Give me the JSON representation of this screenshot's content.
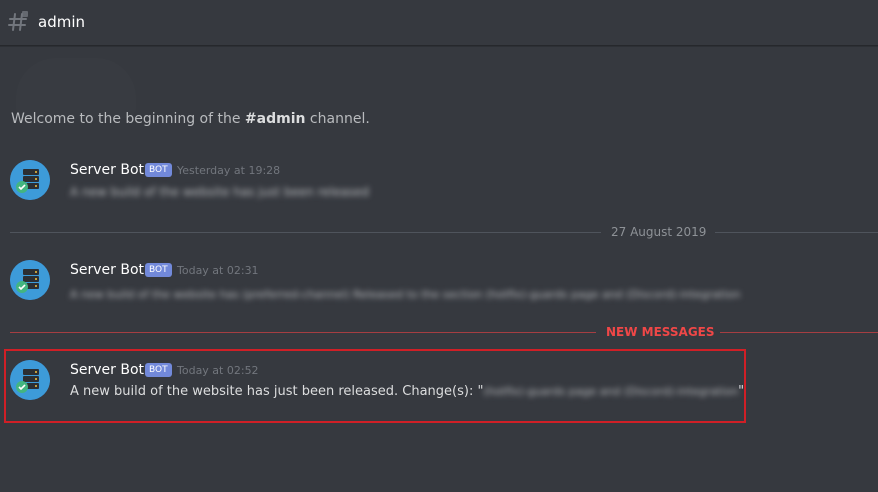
{
  "header": {
    "channel_name": "admin",
    "icon": "hash-icon"
  },
  "welcome": {
    "prefix": "Welcome to the beginning of the ",
    "channel": "#admin",
    "suffix": " channel."
  },
  "messages": [
    {
      "author": "Server Bot",
      "tag": "BOT",
      "timestamp": "Yesterday at 19:28",
      "content": "A new build of the website has just been released"
    },
    {
      "author": "Server Bot",
      "tag": "BOT",
      "timestamp": "Today at 02:31",
      "content": "A new build of the website has (preferred-channel) Released to the section (hotfix)-guards page and (Discord)-integration"
    },
    {
      "author": "Server Bot",
      "tag": "BOT",
      "timestamp": "Today at 02:52",
      "content_prefix": "A new build of the website has just been released. Change(s): \"",
      "content_blurred": "(hotfix)-guards page and (Discord)-integration",
      "content_suffix": "\""
    }
  ],
  "dividers": {
    "date": "27 August 2019",
    "new_messages": "NEW MESSAGES"
  },
  "colors": {
    "background": "#36393f",
    "bot_tag": "#7289da",
    "new_messages": "#f04747",
    "highlight": "#d01f26"
  }
}
